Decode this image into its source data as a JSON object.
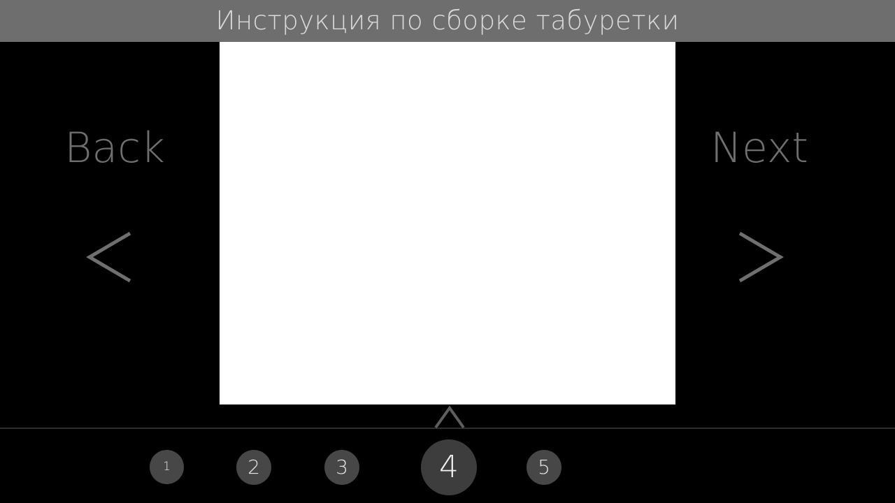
{
  "header": {
    "title": "Инструкция по сборке табуретки"
  },
  "navigation": {
    "back_label": "Back",
    "next_label": "Next",
    "back_icon": "chevron-left-icon",
    "next_icon": "chevron-right-icon"
  },
  "pager": {
    "current_page": 4,
    "indicator_icon": "caret-up-icon",
    "pages": [
      {
        "label": "1"
      },
      {
        "label": "2"
      },
      {
        "label": "3"
      },
      {
        "label": "4"
      },
      {
        "label": "5"
      }
    ]
  },
  "colors": {
    "background": "#000000",
    "title_bar": "#6e6e6e",
    "title_text": "#d9d9d9",
    "nav_text": "#6f6f6f",
    "page_dot": "#474747",
    "active_page_dot": "#3d3d3d",
    "image_area": "#ffffff"
  }
}
